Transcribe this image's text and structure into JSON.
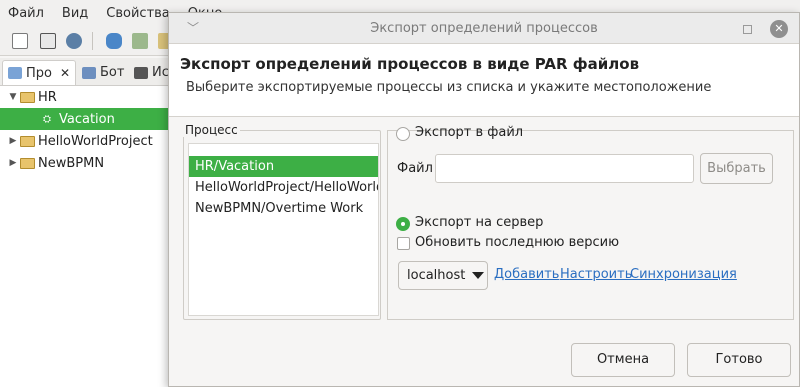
{
  "menu": [
    "Файл",
    "Вид",
    "Свойства",
    "Окно"
  ],
  "view_tabs": [
    {
      "label": "Про",
      "active": true
    },
    {
      "label": "Бот",
      "active": false
    },
    {
      "label": "Ис",
      "active": false
    }
  ],
  "tree": [
    {
      "label": "HR",
      "expanded": true
    },
    {
      "label": "Vacation",
      "selected": true,
      "icon": "process-icon"
    },
    {
      "label": "HelloWorldProject",
      "expanded": false
    },
    {
      "label": "NewBPMN",
      "expanded": false
    }
  ],
  "dialog": {
    "title": "Экспорт определений процессов",
    "header_title": "Экспорт определений процессов в виде PAR файлов",
    "header_desc": "Выберите экспортируемые процессы из списка и укажите местоположение",
    "process_group_label": "Процесс",
    "processes": [
      "HR/Vacation",
      "HelloWorldProject/HelloWorldProcess",
      "NewBPMN/Overtime Work"
    ],
    "export_file_label": "Экспорт в файл",
    "file_label": "Файл",
    "file_value": "",
    "browse_label": "Выбрать",
    "export_server_label": "Экспорт на сервер",
    "update_label": "Обновить последнюю версию",
    "server_value": "localhost",
    "add_link": "Добавить",
    "configure_link": "Настроить",
    "sync_link": "Синхронизация",
    "cancel_label": "Отмена",
    "finish_label": "Готово"
  },
  "colors": {
    "selection": "#3daf45",
    "link": "#2a6ec1"
  }
}
